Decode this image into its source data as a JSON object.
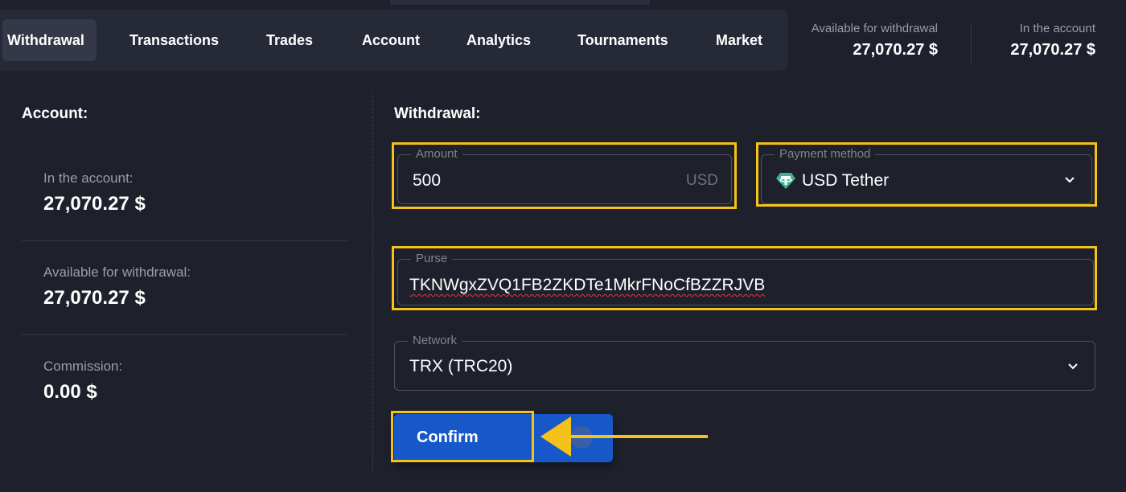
{
  "nav": {
    "tabs": [
      {
        "label": "Withdrawal"
      },
      {
        "label": "Transactions"
      },
      {
        "label": "Trades"
      },
      {
        "label": "Account"
      },
      {
        "label": "Analytics"
      },
      {
        "label": "Tournaments"
      },
      {
        "label": "Market"
      }
    ],
    "active_tab": "Withdrawal"
  },
  "balances": {
    "available": {
      "label": "Available for withdrawal",
      "value": "27,070.27 $"
    },
    "account": {
      "label": "In the account",
      "value": "27,070.27 $"
    }
  },
  "account_panel": {
    "title": "Account:",
    "in_account": {
      "label": "In the account:",
      "value": "27,070.27 $"
    },
    "available": {
      "label": "Available for withdrawal:",
      "value": "27,070.27 $"
    },
    "commission": {
      "label": "Commission:",
      "value": "0.00 $"
    }
  },
  "withdrawal_form": {
    "title": "Withdrawal:",
    "amount": {
      "label": "Amount",
      "value": "500",
      "currency": "USD"
    },
    "payment_method": {
      "label": "Payment method",
      "value": "USD Tether",
      "icon": "tether-icon"
    },
    "purse": {
      "label": "Purse",
      "value": "TKNWgxZVQ1FB2ZKDTe1MkrFNoCfBZZRJVB"
    },
    "network": {
      "label": "Network",
      "value": "TRX (TRC20)"
    },
    "confirm_label": "Confirm"
  },
  "colors": {
    "background": "#1e202b",
    "highlight": "#f4c21a",
    "button": "#1758c8",
    "muted_text": "#9a9eaa"
  }
}
